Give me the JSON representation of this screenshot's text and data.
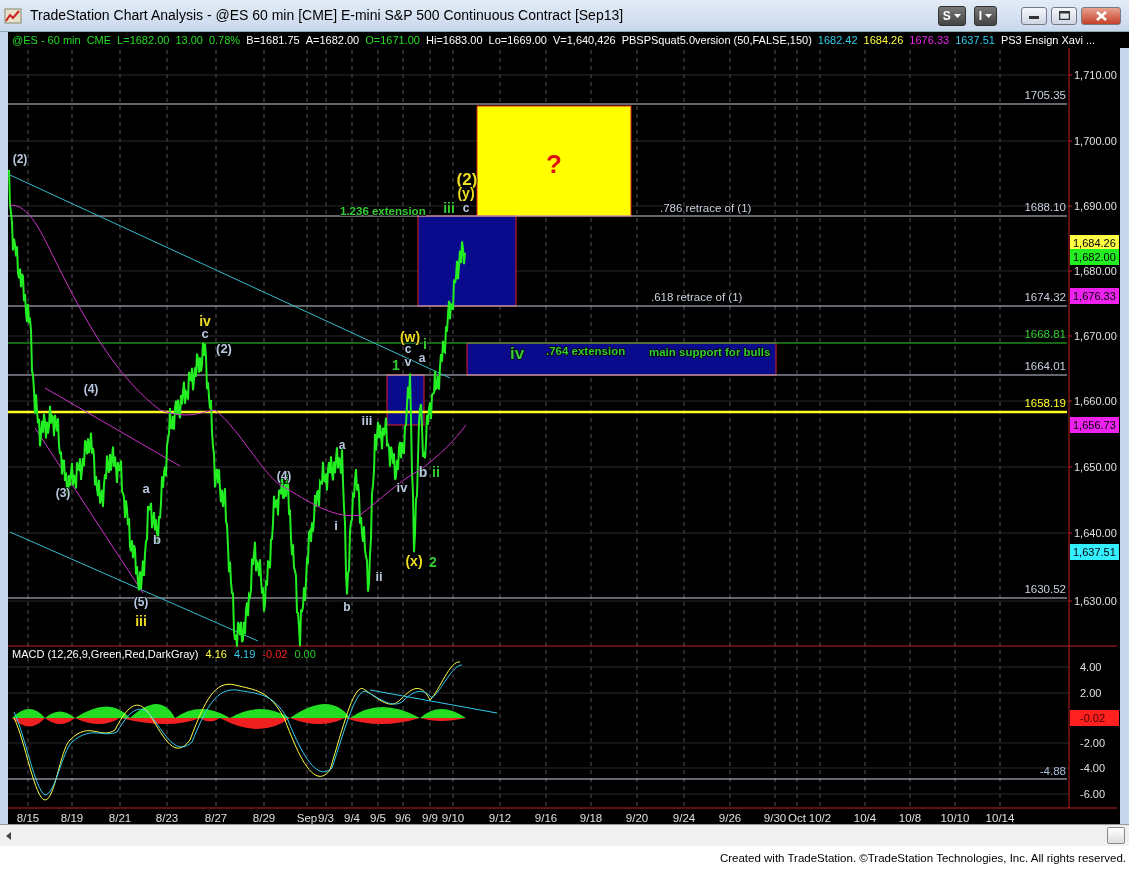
{
  "window": {
    "title": "TradeStation Chart Analysis - @ES 60 min [CME] E-mini S&P 500 Continuous Contract [Sep13]"
  },
  "title_buttons": [
    {
      "label": "S"
    },
    {
      "label": "I"
    }
  ],
  "legend": [
    {
      "text": "@ES - 60 min",
      "color": "#22dd22"
    },
    {
      "text": "CME",
      "color": "#22dd22"
    },
    {
      "text": "L=1682.00",
      "color": "#22dd22"
    },
    {
      "text": "13.00",
      "color": "#22dd22"
    },
    {
      "text": "0.78%",
      "color": "#22dd22"
    },
    {
      "text": "B=1681.75",
      "color": "#ffffff"
    },
    {
      "text": "A=1682.00",
      "color": "#ffffff"
    },
    {
      "text": "O=1671.00",
      "color": "#22dd22"
    },
    {
      "text": "Hi=1683.00",
      "color": "#ffffff"
    },
    {
      "text": "Lo=1669.00",
      "color": "#ffffff"
    },
    {
      "text": "V=1,640,426",
      "color": "#ffffff"
    },
    {
      "text": "PBSPSquat5.0version (50,FALSE,150)",
      "color": "#ffffff"
    },
    {
      "text": "1682.42",
      "color": "#33ccee"
    },
    {
      "text": "1684.26",
      "color": "#ffff44"
    },
    {
      "text": "1676.33",
      "color": "#ee22ee"
    },
    {
      "text": "1637.51",
      "color": "#33ccee"
    },
    {
      "text": "PS3 Ensign Xavi ...",
      "color": "#ffffff"
    }
  ],
  "price_axis": [
    "1,710.00",
    "1,700.00",
    "1,690.00",
    "1,680.00",
    "1,670.00",
    "1,660.00",
    "1,650.00",
    "1,640.00",
    "1,630.00"
  ],
  "price_tags": [
    {
      "text": "1,684.26",
      "color": "#ffff44"
    },
    {
      "text": "1,682.00",
      "color": "#22ee22"
    },
    {
      "text": "1,676.33",
      "color": "#ee22ee"
    },
    {
      "text": "1,656.73",
      "color": "#ee22ee"
    },
    {
      "text": "1,637.51",
      "color": "#33eeff"
    }
  ],
  "levels": [
    {
      "label": "1705.35",
      "color": "#c8d0dc"
    },
    {
      "label": "1688.10",
      "color": "#c8d0dc"
    },
    {
      "label": "1674.32",
      "color": "#c8d0dc"
    },
    {
      "label": "1668.81",
      "color": "#33cc33"
    },
    {
      "label": "1664.01",
      "color": "#c8d0dc"
    },
    {
      "label": "1658.19",
      "color": "#ffff22"
    },
    {
      "label": "1630.52",
      "color": "#c8d0dc"
    }
  ],
  "zones": [
    {
      "kind": "target",
      "label": "?"
    },
    {
      "kind": "blue"
    },
    {
      "kind": "blue"
    },
    {
      "kind": "blue"
    }
  ],
  "annotations": [
    {
      "text": "(2)",
      "color": "#b8c8e0",
      "kind": "wave"
    },
    {
      "text": "iv",
      "color": "#eedd22",
      "kind": "big"
    },
    {
      "text": "c",
      "color": "#b8c8e0",
      "kind": "small"
    },
    {
      "text": "(2)",
      "color": "#b8c8e0",
      "kind": "small"
    },
    {
      "text": "(4)",
      "color": "#b8c8e0",
      "kind": "wave"
    },
    {
      "text": "(3)",
      "color": "#b8c8e0",
      "kind": "wave"
    },
    {
      "text": "a",
      "color": "#b8c8e0",
      "kind": "small"
    },
    {
      "text": "b",
      "color": "#b8c8e0",
      "kind": "small"
    },
    {
      "text": "(5)",
      "color": "#b8c8e0",
      "kind": "wave"
    },
    {
      "text": "iii",
      "color": "#eedd22",
      "kind": "big"
    },
    {
      "text": "(4)",
      "color": "#b8c8e0",
      "kind": "wave"
    },
    {
      "text": "a",
      "color": "#b8c8e0",
      "kind": "wave"
    },
    {
      "text": "i",
      "color": "#b8c8e0",
      "kind": "small"
    },
    {
      "text": "b",
      "color": "#b8c8e0",
      "kind": "wave"
    },
    {
      "text": "iii",
      "color": "#b8c8e0",
      "kind": "small"
    },
    {
      "text": "ii",
      "color": "#b8c8e0",
      "kind": "small"
    },
    {
      "text": "iv",
      "color": "#b8c8e0",
      "kind": "small"
    },
    {
      "text": "b",
      "color": "#b8c8e0",
      "kind": "big"
    },
    {
      "text": "ii",
      "color": "#33cc33",
      "kind": "big"
    },
    {
      "text": "(x)",
      "color": "#eedd22",
      "kind": "big"
    },
    {
      "text": "2",
      "color": "#33cc33",
      "kind": "big"
    },
    {
      "text": "(w)",
      "color": "#eedd22",
      "kind": "big"
    },
    {
      "text": "i",
      "color": "#33cc33",
      "kind": "big"
    },
    {
      "text": "c",
      "color": "#b8c8e0",
      "kind": "wave"
    },
    {
      "text": "a",
      "color": "#b8c8e0",
      "kind": "wave"
    },
    {
      "text": "1",
      "color": "#33cc33",
      "kind": "big"
    },
    {
      "text": "v",
      "color": "#b8c8e0",
      "kind": "small"
    },
    {
      "text": "(2)",
      "color": "#eedd22",
      "kind": "huge"
    },
    {
      "text": "(y)",
      "color": "#eedd22",
      "kind": "big"
    },
    {
      "text": "iii",
      "color": "#33cc33",
      "kind": "big"
    },
    {
      "text": "c",
      "color": "#b8c8e0",
      "kind": "wave"
    },
    {
      "text": "iv",
      "color": "#33cc33",
      "kind": "huge"
    },
    {
      "text": "1.236 extension",
      "color": "#33cc33",
      "kind": "note"
    },
    {
      "text": ".786 retrace of (1)",
      "color": "#c8d0dc",
      "kind": "plain"
    },
    {
      "text": ".618 retrace of (1)",
      "color": "#c8d0dc",
      "kind": "plain"
    },
    {
      "text": ".764 extension",
      "color": "#33cc33",
      "kind": "note"
    },
    {
      "text": "main support for bulls",
      "color": "#33cc33",
      "kind": "note"
    }
  ],
  "macd": {
    "legend": [
      {
        "text": "MACD (12,26,9,Green,Red,DarkGray)",
        "color": "#ffffff"
      },
      {
        "text": "4.16",
        "color": "#ffff44"
      },
      {
        "text": "4.19",
        "color": "#33ccee"
      },
      {
        "text": "-0.02",
        "color": "#ff2222"
      },
      {
        "text": "0.00",
        "color": "#22cc22"
      }
    ],
    "ticks": [
      "4.00",
      "2.00",
      "-2.00",
      "-4.00",
      "-6.00"
    ],
    "tag": "-0.02",
    "level_label": "-4.88"
  },
  "date_axis": [
    "8/15",
    "8/19",
    "8/21",
    "8/23",
    "8/27",
    "8/29",
    "Sep",
    "9/3",
    "9/4",
    "9/5",
    "9/6",
    "9/9",
    "9/10",
    "9/12",
    "9/16",
    "9/18",
    "9/20",
    "9/24",
    "9/26",
    "9/30",
    "Oct",
    "10/2",
    "10/4",
    "10/8",
    "10/10",
    "10/14"
  ],
  "footer": "Created with TradeStation. ©TradeStation Technologies, Inc. All rights reserved."
}
